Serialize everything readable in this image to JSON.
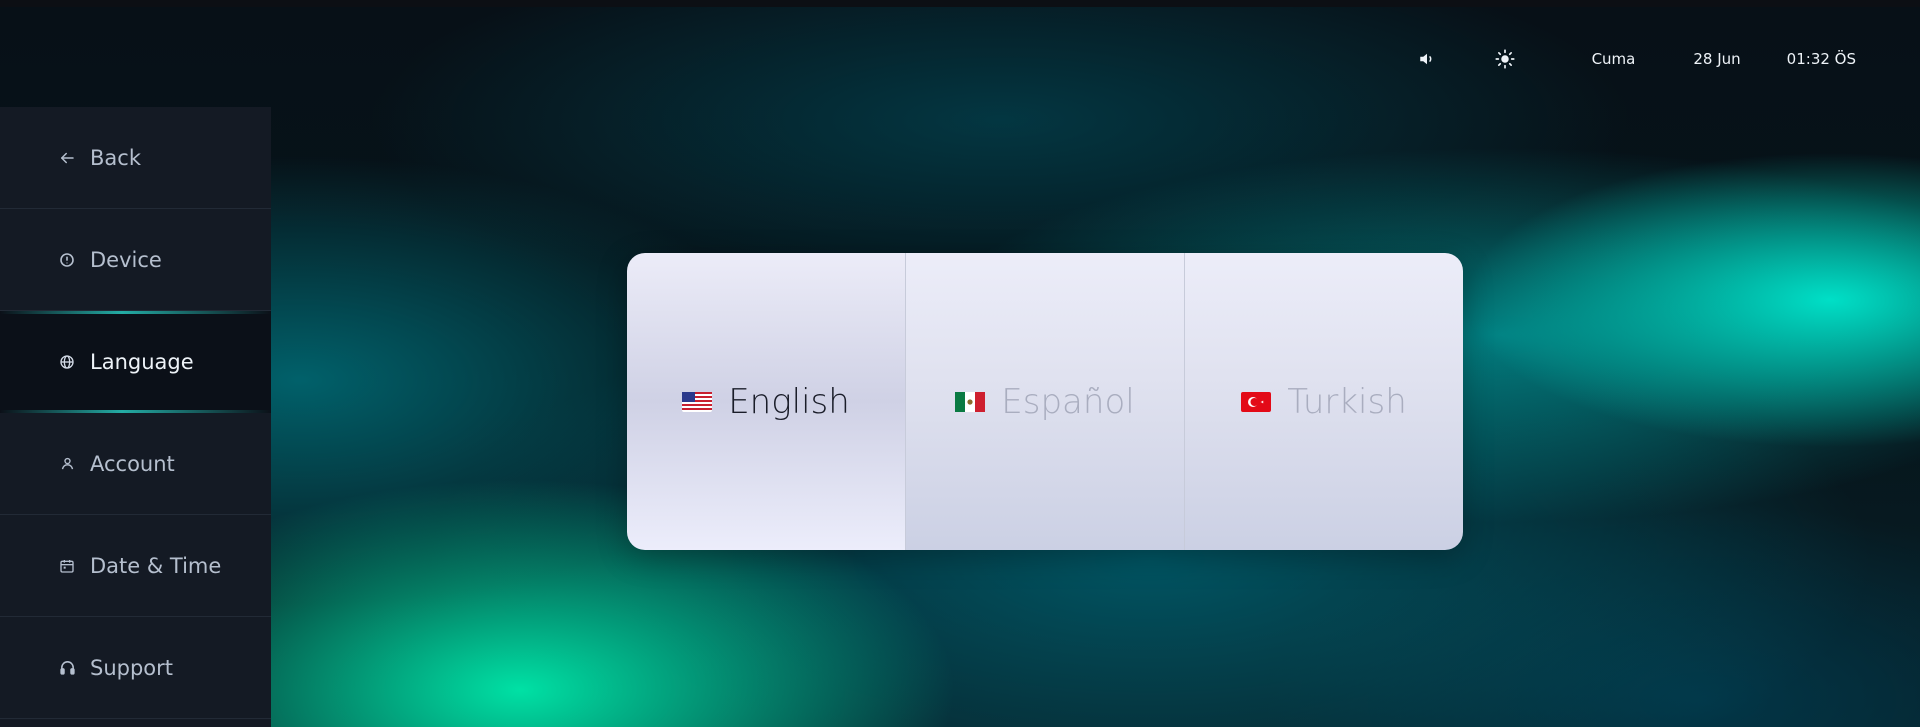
{
  "topbar": {
    "volume_icon": "speaker-icon",
    "brightness_icon": "sun-icon",
    "day": "Cuma",
    "date": "28 Jun",
    "time": "01:32 ÖS"
  },
  "sidebar": {
    "items": [
      {
        "label": "Back",
        "icon": "arrow-left-icon"
      },
      {
        "label": "Device",
        "icon": "info-icon"
      },
      {
        "label": "Language",
        "icon": "globe-icon",
        "active": true
      },
      {
        "label": "Account",
        "icon": "user-icon"
      },
      {
        "label": "Date & Time",
        "icon": "calendar-icon"
      },
      {
        "label": "Support",
        "icon": "headphones-icon"
      }
    ]
  },
  "languages": {
    "selected": "English",
    "options": [
      {
        "label": "English",
        "flag": "us-flag-icon"
      },
      {
        "label": "Español",
        "flag": "mexico-flag-icon"
      },
      {
        "label": "Turkish",
        "flag": "turkey-flag-icon"
      }
    ]
  },
  "colors": {
    "accent": "#28c8be",
    "sidebar_bg": "#141a24",
    "active_bg": "#0b1018",
    "panel_text_selected": "#1a1d29",
    "panel_text": "#a9adbf"
  }
}
